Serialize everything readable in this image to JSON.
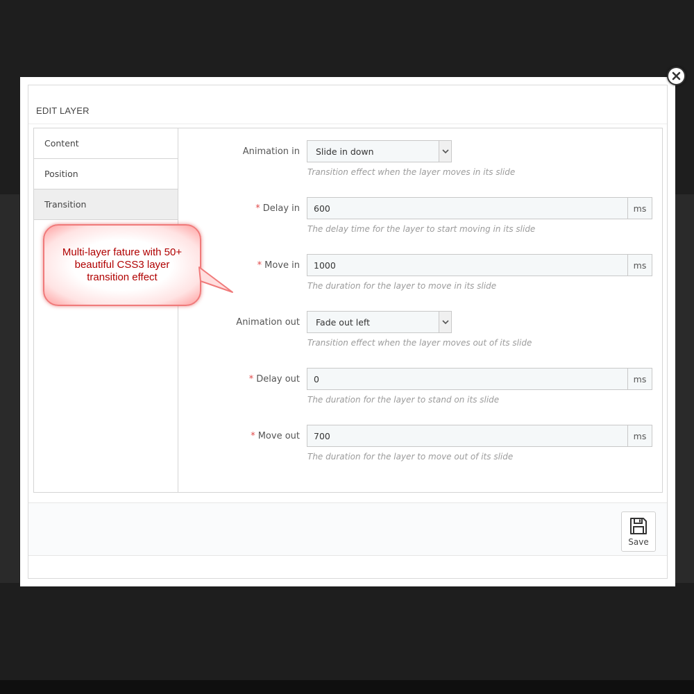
{
  "modal": {
    "title": "EDIT LAYER",
    "close_icon": "close-icon"
  },
  "tabs": [
    {
      "label": "Content",
      "active": false
    },
    {
      "label": "Position",
      "active": false
    },
    {
      "label": "Transition",
      "active": true
    }
  ],
  "callout": {
    "text": "Multi-layer fature with 50+ beautiful CSS3 layer transition effect"
  },
  "form": {
    "animation_in": {
      "label": "Animation in",
      "value": "Slide in down",
      "help": "Transition effect when the layer moves in its slide"
    },
    "delay_in": {
      "required": "*",
      "label": "Delay in",
      "value": "600",
      "unit": "ms",
      "help": "The delay time for the layer to start moving in its slide"
    },
    "move_in": {
      "required": "*",
      "label": "Move in",
      "value": "1000",
      "unit": "ms",
      "help": "The duration for the layer to move in its slide"
    },
    "animation_out": {
      "label": "Animation out",
      "value": "Fade out left",
      "help": "Transition effect when the layer moves out of its slide"
    },
    "delay_out": {
      "required": "*",
      "label": "Delay out",
      "value": "0",
      "unit": "ms",
      "help": "The duration for the layer to stand on its slide"
    },
    "move_out": {
      "required": "*",
      "label": "Move out",
      "value": "700",
      "unit": "ms",
      "help": "The duration for the layer to move out of its slide"
    }
  },
  "footer": {
    "save_label": "Save",
    "save_icon": "floppy-disk-icon"
  },
  "colors": {
    "required": "#e14a4a",
    "callout_text": "#b00000",
    "callout_border": "#f07a7a",
    "backdrop": "#1e1e1e"
  }
}
